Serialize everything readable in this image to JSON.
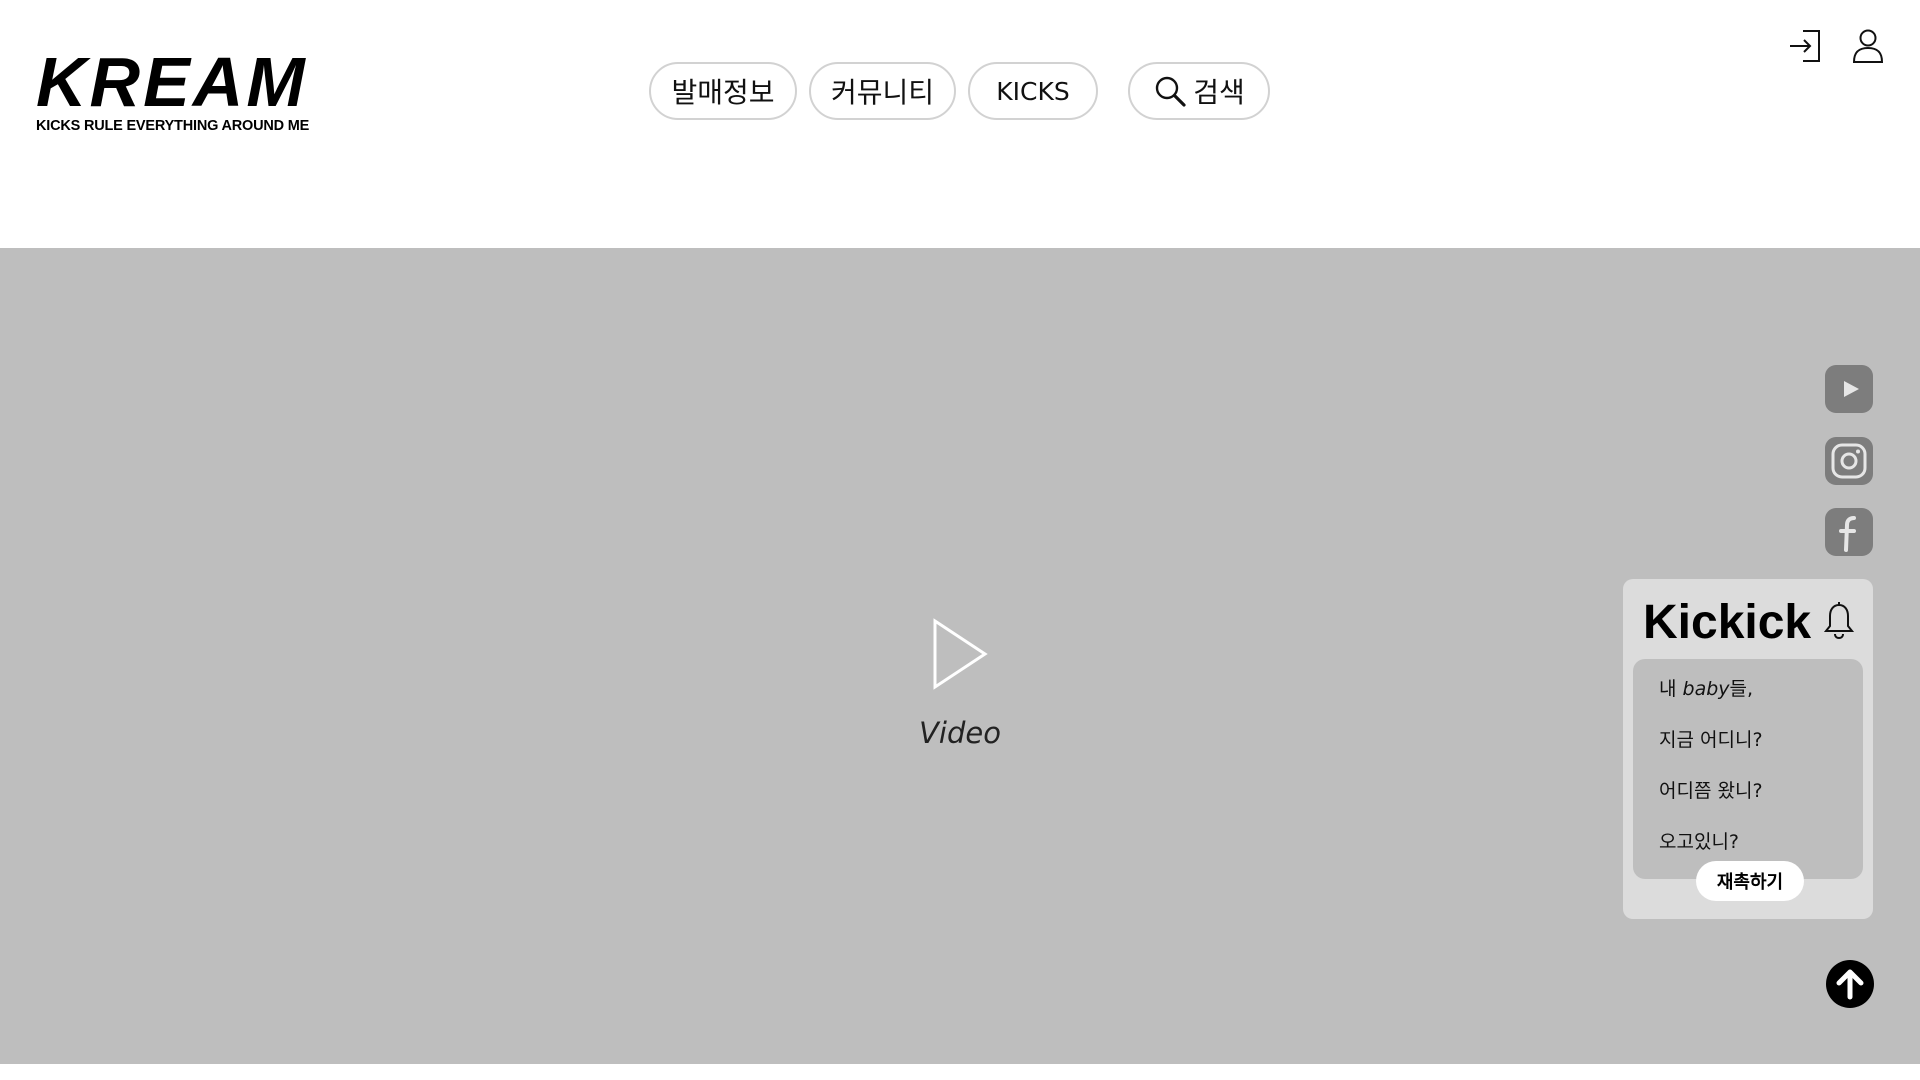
{
  "header": {
    "logo": {
      "wordmark": "KREAM",
      "tagline": "KICKS RULE EVERYTHING AROUND ME"
    },
    "nav": [
      {
        "label": "발매정보"
      },
      {
        "label": "커뮤니티"
      },
      {
        "label": "KICKS"
      }
    ],
    "search": {
      "label": "검색",
      "icon": "search-icon"
    },
    "icons": {
      "login": "login-icon",
      "profile": "user-icon"
    }
  },
  "hero": {
    "video_label": "Video",
    "background_color": "#bebebe"
  },
  "social": {
    "items": [
      {
        "icon": "youtube-icon"
      },
      {
        "icon": "instagram-icon"
      },
      {
        "icon": "facebook-icon"
      }
    ]
  },
  "kickick": {
    "title": "Kickick",
    "bell_icon": "bell-icon",
    "messages": {
      "line1_prefix": "내 ",
      "line1_emph": "baby",
      "line1_suffix": "들,",
      "line2": "지금 어디니?",
      "line3": "어디쯤 왔니?",
      "line4": "오고있니?"
    },
    "button_label": "재촉하기"
  },
  "scroll_top": {
    "icon": "arrow-up-circle-icon"
  }
}
